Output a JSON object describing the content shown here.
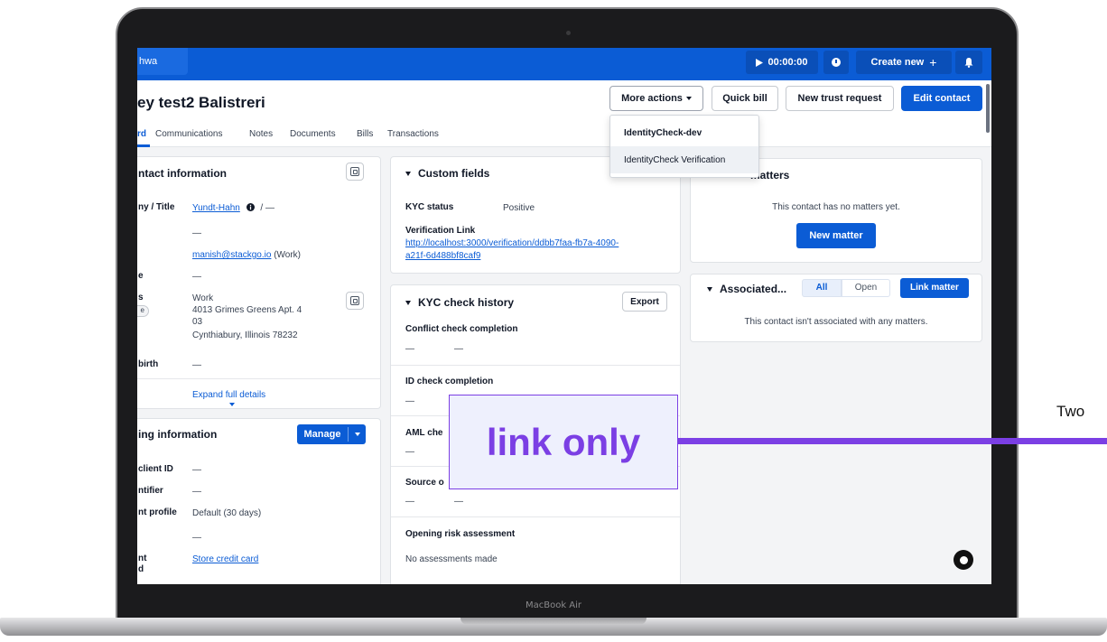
{
  "device": {
    "brand_label": "MacBook Air"
  },
  "topbar": {
    "workspace_label": "hwa",
    "timer": "00:00:00",
    "create_label": "Create new",
    "create_plus": "+"
  },
  "header": {
    "title": "ey test2 Balistreri",
    "more_actions_label": "More actions",
    "quick_bill_label": "Quick bill",
    "new_trust_request_label": "New trust request",
    "edit_contact_label": "Edit contact"
  },
  "dropdown": {
    "items": [
      "IdentityCheck-dev",
      "IdentityCheck Verification"
    ]
  },
  "tabs": [
    "rd",
    "Communications",
    "Notes",
    "Documents",
    "Bills",
    "Transactions"
  ],
  "contact_info": {
    "title": "ntact information",
    "company_label": "ny / Title",
    "company_value": "Yundt-Hahn",
    "company_suffix": "/ —",
    "dash_1": "—",
    "email_value": "manish@stackgo.io",
    "email_type": "(Work)",
    "e_label": "e",
    "dash_2": "—",
    "address_label": "s",
    "address_badge": "e",
    "address_type": "Work",
    "address_line1": "4013 Grimes Greens Apt. 4",
    "address_line2": "03",
    "address_line3": "Cynthiabury, Illinois 78232",
    "birth_label": "birth",
    "birth_value": "—",
    "expand_label": "Expand full details"
  },
  "billing_info": {
    "title": "ing information",
    "manage_label": "Manage",
    "client_id_label": "client ID",
    "client_id_value": "—",
    "identifier_label": "ntifier",
    "identifier_value": "—",
    "profile_label": "nt profile",
    "profile_value": "Default (30 days)",
    "dash": "—",
    "payment_label_1": "nt",
    "payment_label_2": "d",
    "payment_value": "Store credit card"
  },
  "custom_fields": {
    "title": "Custom fields",
    "kyc_status_label": "KYC status",
    "kyc_status_value": "Positive",
    "verification_link_label": "Verification Link",
    "verification_link_line1": "http://localhost:3000/verification/ddbb7faa-fb7a-4090-",
    "verification_link_line2": "a21f-6d488bf8caf9"
  },
  "kyc_history": {
    "title": "KYC check history",
    "export_label": "Export",
    "conflict_label": "Conflict check completion",
    "conflict_dash_a": "—",
    "conflict_dash_b": "—",
    "id_label": "ID check completion",
    "id_dash": "—",
    "aml_label": "AML che",
    "aml_dash": "—",
    "source_label": "Source o",
    "source_dash_a": "—",
    "source_dash_b": "—",
    "risk_label": "Opening risk assessment",
    "risk_value": "No assessments made"
  },
  "matters": {
    "title": "matters",
    "empty_text": "This contact has no matters yet.",
    "new_matter_label": "New matter"
  },
  "associated": {
    "title": "Associated...",
    "filter_all": "All",
    "filter_open": "Open",
    "link_matter_label": "Link matter",
    "empty_text": "This contact isn't associated with any matters."
  },
  "annotation": {
    "callout_text": "link only",
    "side_text": "Two"
  },
  "colors": {
    "brand_blue": "#0b5cd5",
    "annotation_purple": "#7b3fe4"
  }
}
